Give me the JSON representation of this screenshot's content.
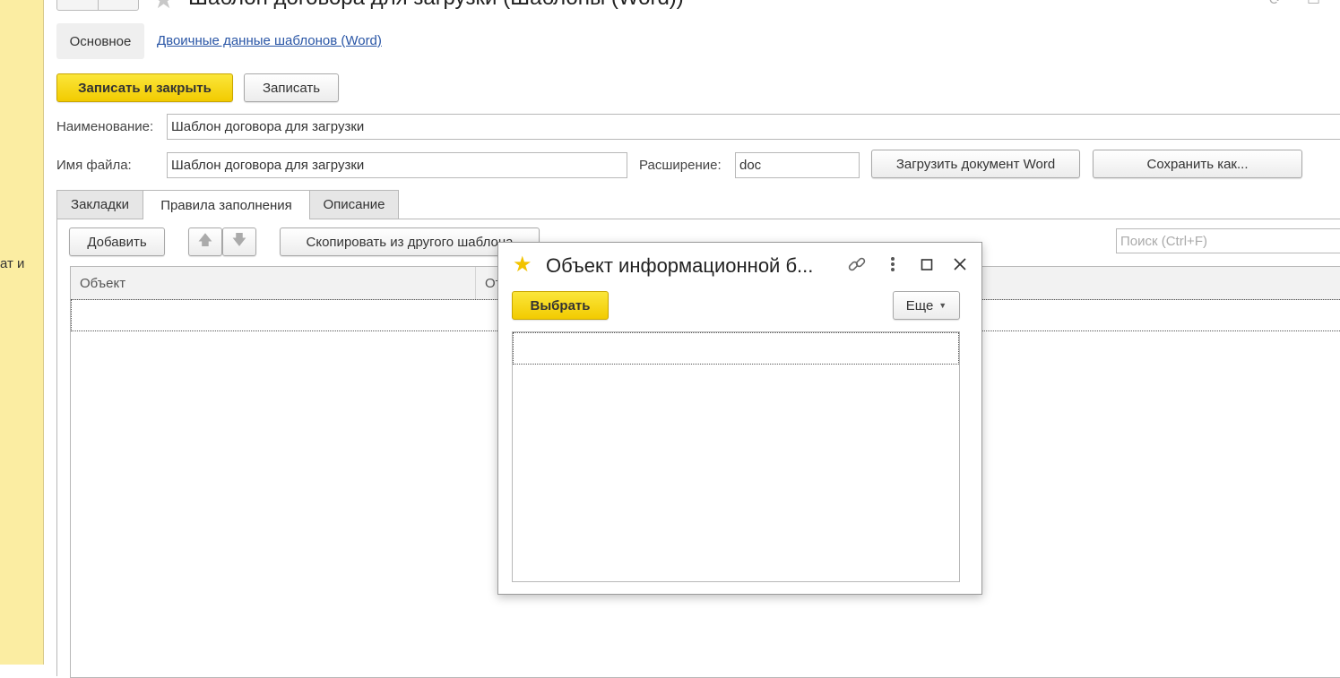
{
  "left_panel": {
    "cut_text": "ат и"
  },
  "header": {
    "back_arrow": "←",
    "forward_arrow": "→",
    "title": "Шаблон договора для загрузки (Шаблоны (Word))"
  },
  "form_tabs": {
    "main": "Основное",
    "binary": "Двоичные данные шаблонов (Word)"
  },
  "toolbar": {
    "save_close": "Записать и закрыть",
    "save": "Записать"
  },
  "fields": {
    "name_label": "Наименование:",
    "name_value": "Шаблон договора для загрузки",
    "filename_label": "Имя файла:",
    "filename_value": "Шаблон договора для загрузки",
    "extension_label": "Расширение:",
    "extension_value": "doc",
    "load_word": "Загрузить документ Word",
    "save_as": "Сохранить как..."
  },
  "tabs": [
    {
      "label": "Закладки",
      "active": false
    },
    {
      "label": "Правила заполнения",
      "active": true
    },
    {
      "label": "Описание",
      "active": false
    }
  ],
  "rules": {
    "add": "Добавить",
    "up_icon": "arrow-up-icon",
    "down_icon": "arrow-down-icon",
    "copy_from": "Скопировать из другого шаблона",
    "search_placeholder": "Поиск (Ctrl+F)",
    "columns": [
      "Объект",
      "От"
    ]
  },
  "dialog": {
    "title": "Объект информационной б...",
    "choose": "Выбрать",
    "more": "Еще"
  },
  "colors": {
    "accent_yellow": "#f5d20a",
    "left_panel": "#fbeda2",
    "link": "#2a56a6"
  }
}
